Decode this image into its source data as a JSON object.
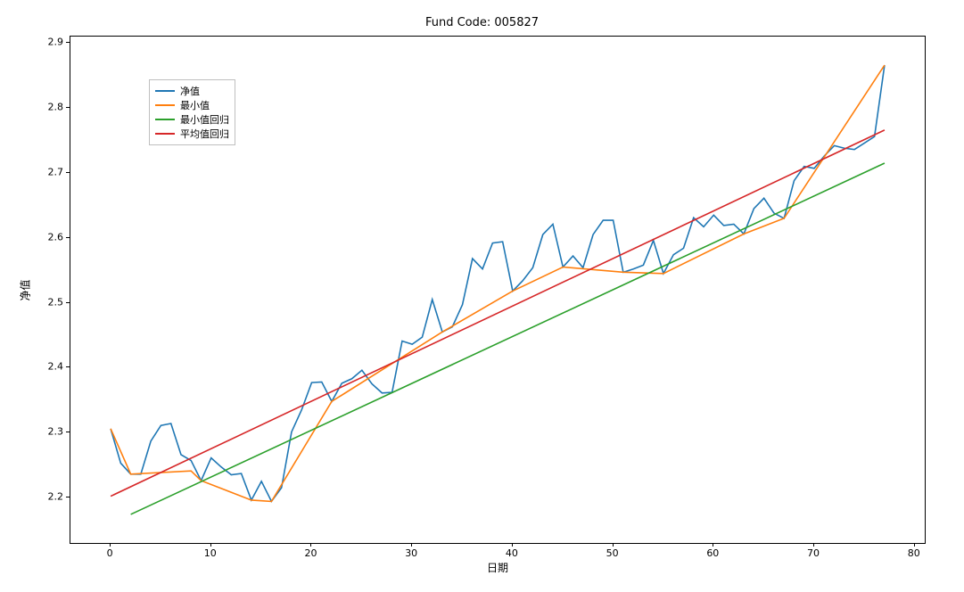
{
  "chart_data": {
    "type": "line",
    "title": "Fund Code: 005827",
    "xlabel": "日期",
    "ylabel": "净值",
    "xlim": [
      -4,
      81
    ],
    "ylim": [
      2.13,
      2.91
    ],
    "xticks": [
      0,
      10,
      20,
      30,
      40,
      50,
      60,
      70,
      80
    ],
    "yticks": [
      2.2,
      2.3,
      2.4,
      2.5,
      2.6,
      2.7,
      2.8,
      2.9
    ],
    "legend_position": "upper-left",
    "series": [
      {
        "name": "净值",
        "color": "#1f77b4",
        "x": [
          0,
          1,
          2,
          3,
          4,
          5,
          6,
          7,
          8,
          9,
          10,
          11,
          12,
          13,
          14,
          15,
          16,
          17,
          18,
          19,
          20,
          21,
          22,
          23,
          24,
          25,
          26,
          27,
          28,
          29,
          30,
          31,
          32,
          33,
          34,
          35,
          36,
          37,
          38,
          39,
          40,
          41,
          42,
          43,
          44,
          45,
          46,
          47,
          48,
          49,
          50,
          51,
          52,
          53,
          54,
          55,
          56,
          57,
          58,
          59,
          60,
          61,
          62,
          63,
          64,
          65,
          66,
          67,
          68,
          69,
          70,
          71,
          72,
          73,
          74,
          75,
          76,
          77
        ],
        "values": [
          2.306,
          2.253,
          2.236,
          2.236,
          2.287,
          2.311,
          2.314,
          2.266,
          2.257,
          2.226,
          2.261,
          2.247,
          2.235,
          2.237,
          2.196,
          2.225,
          2.194,
          2.215,
          2.301,
          2.335,
          2.377,
          2.378,
          2.348,
          2.376,
          2.383,
          2.396,
          2.375,
          2.361,
          2.362,
          2.441,
          2.436,
          2.447,
          2.505,
          2.455,
          2.463,
          2.497,
          2.568,
          2.552,
          2.592,
          2.594,
          2.518,
          2.534,
          2.554,
          2.605,
          2.621,
          2.555,
          2.572,
          2.554,
          2.605,
          2.627,
          2.627,
          2.547,
          2.552,
          2.558,
          2.596,
          2.545,
          2.574,
          2.584,
          2.631,
          2.617,
          2.635,
          2.619,
          2.621,
          2.606,
          2.645,
          2.661,
          2.638,
          2.63,
          2.688,
          2.71,
          2.707,
          2.726,
          2.742,
          2.738,
          2.736,
          2.746,
          2.756,
          2.866
        ]
      },
      {
        "name": "最小值",
        "color": "#ff7f0e",
        "x": [
          0,
          2,
          8,
          9,
          14,
          16,
          22,
          33,
          40,
          45,
          51,
          55,
          63,
          67,
          77
        ],
        "values": [
          2.306,
          2.236,
          2.241,
          2.226,
          2.196,
          2.194,
          2.348,
          2.455,
          2.518,
          2.555,
          2.547,
          2.545,
          2.606,
          2.63,
          2.866
        ]
      },
      {
        "name": "最小值回归",
        "color": "#2ca02c",
        "x": [
          2,
          77
        ],
        "values": [
          2.174,
          2.715
        ]
      },
      {
        "name": "平均值回归",
        "color": "#d62728",
        "x": [
          0,
          77
        ],
        "values": [
          2.202,
          2.766
        ]
      }
    ]
  },
  "colors": {
    "net_value": "#1f77b4",
    "min_value": "#ff7f0e",
    "min_regression": "#2ca02c",
    "avg_regression": "#d62728"
  }
}
